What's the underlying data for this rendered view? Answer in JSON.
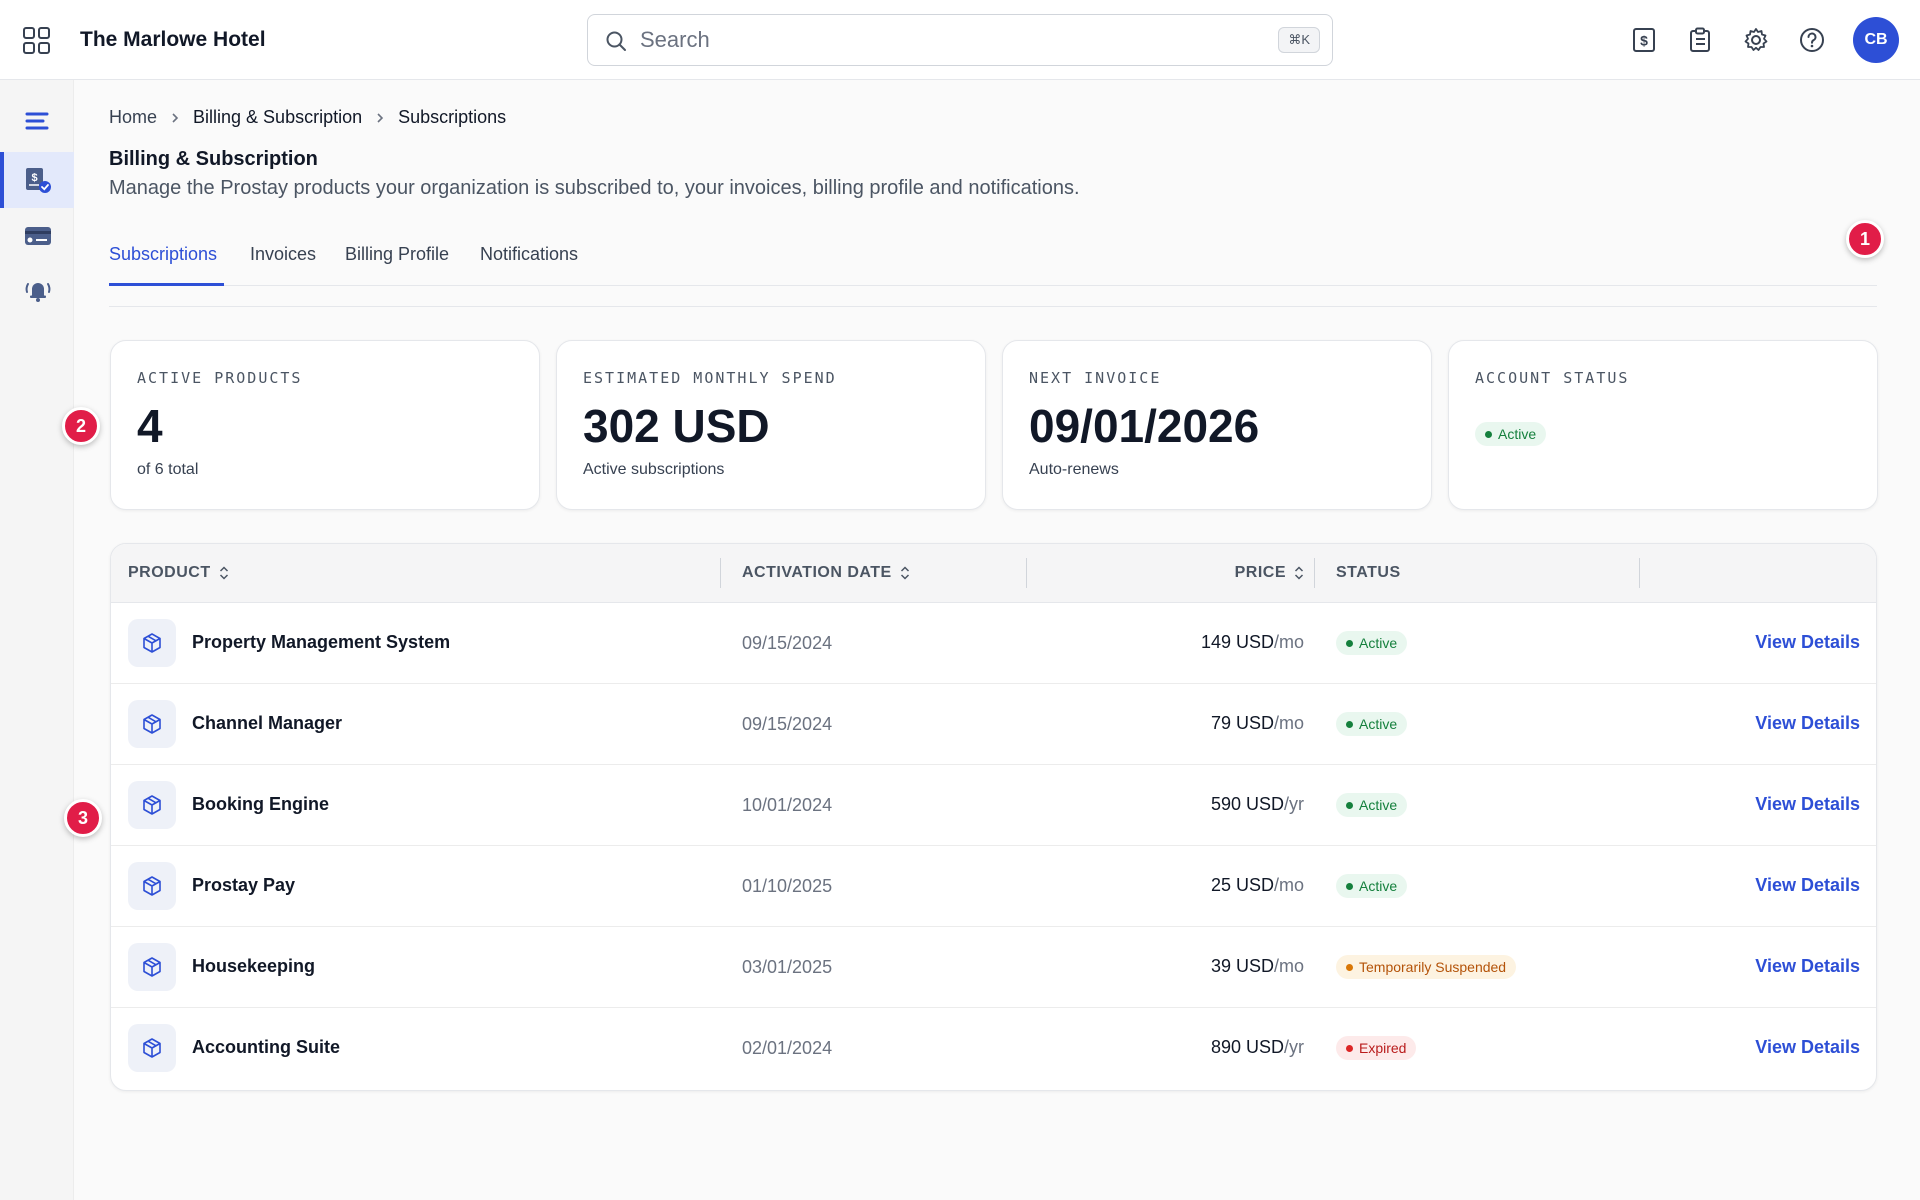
{
  "header": {
    "hotel_name": "The Marlowe Hotel",
    "search_placeholder": "Search",
    "search_shortcut": "⌘K",
    "avatar_initials": "CB",
    "actions": [
      "billing-icon",
      "clipboard-icon",
      "gear-icon",
      "help-icon"
    ]
  },
  "sidebar": {
    "items": [
      "menu-icon",
      "billing-subscription-icon",
      "payment-card-icon",
      "notifications-bell-icon"
    ],
    "active_index": 1
  },
  "breadcrumb": [
    "Home",
    "Billing & Subscription",
    "Subscriptions"
  ],
  "page": {
    "title": "Billing & Subscription",
    "subtitle": "Manage the Prostay products your organization is subscribed to, your invoices, billing profile and notifications."
  },
  "tabs": {
    "items": [
      "Subscriptions",
      "Invoices",
      "Billing Profile",
      "Notifications"
    ],
    "active": "Subscriptions"
  },
  "markers": [
    "1",
    "2",
    "3"
  ],
  "cards": {
    "active_products": {
      "label": "ACTIVE PRODUCTS",
      "value": "4",
      "note": "of 6 total"
    },
    "monthly_spend": {
      "label": "ESTIMATED MONTHLY SPEND",
      "value": "302 USD",
      "note": "Active subscriptions"
    },
    "next_invoice": {
      "label": "NEXT INVOICE",
      "value": "09/01/2026",
      "note": "Auto-renews"
    },
    "account_status": {
      "label": "ACCOUNT STATUS",
      "badge": "Active"
    }
  },
  "table": {
    "headers": {
      "product": "PRODUCT",
      "activation_date": "ACTIVATION DATE",
      "price": "PRICE",
      "status": "STATUS"
    },
    "rows": [
      {
        "product": "Property Management System",
        "date": "09/15/2024",
        "price": "149 USD",
        "period": "/mo",
        "status": "Active",
        "action": "View Details"
      },
      {
        "product": "Channel Manager",
        "date": "09/15/2024",
        "price": "79 USD",
        "period": "/mo",
        "status": "Active",
        "action": "View Details"
      },
      {
        "product": "Booking Engine",
        "date": "10/01/2024",
        "price": "590 USD",
        "period": "/yr",
        "status": "Active",
        "action": "View Details"
      },
      {
        "product": "Prostay Pay",
        "date": "01/10/2025",
        "price": "25 USD",
        "period": "/mo",
        "status": "Active",
        "action": "View Details"
      },
      {
        "product": "Housekeeping",
        "date": "03/01/2025",
        "price": "39 USD",
        "period": "/mo",
        "status": "Temporarily Suspended",
        "action": "View Details"
      },
      {
        "product": "Accounting Suite",
        "date": "02/01/2024",
        "price": "890 USD",
        "period": "/yr",
        "status": "Expired",
        "action": "View Details"
      }
    ]
  },
  "colors": {
    "accent": "#2d4fd6",
    "active": "#15803d",
    "suspended": "#b45309",
    "expired": "#b91c1c",
    "marker": "#e11d48"
  }
}
